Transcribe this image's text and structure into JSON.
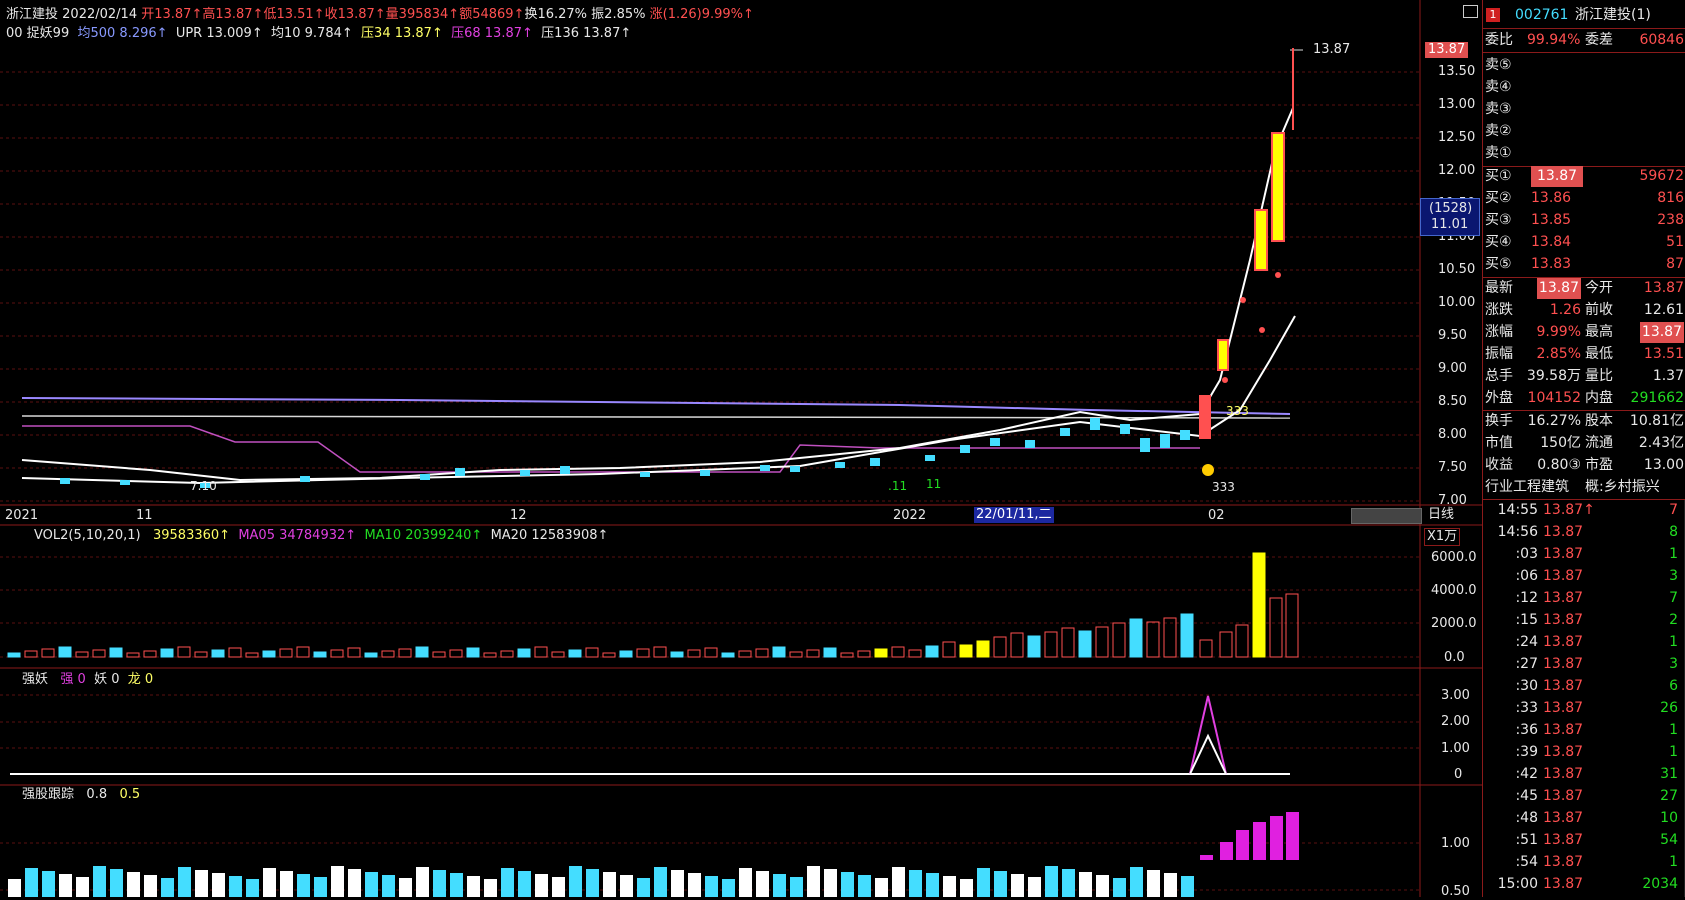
{
  "header": {
    "stock_name": "浙江建投",
    "date": "2022/02/14",
    "open": "开13.87↑",
    "high": "高13.87↑",
    "low": "低13.51↑",
    "close": "收13.87↑",
    "volume": "量395834↑",
    "amount": "额54869↑",
    "turnover": "换16.27%",
    "amplitude": "振2.85%",
    "change": "涨(1.26)9.99%↑"
  },
  "indicator_line": {
    "prefix": "00 捉妖99",
    "ma500": "均500 8.296↑",
    "upr": "UPR 13.009↑",
    "ma10": "均10 9.784↑",
    "p34": "压34 13.87↑",
    "p68": "压68 13.87↑",
    "p136": "压136 13.87↑"
  },
  "price_axis": [
    "13.50",
    "13.00",
    "12.50",
    "12.00",
    "11.50",
    "11.00",
    "10.50",
    "10.00",
    "9.50",
    "9.00",
    "8.50",
    "8.00",
    "7.50",
    "7.00"
  ],
  "price_tag_top": "13.87",
  "price_marker_label": "13.87",
  "crosshair_box": {
    "count": "(1528)",
    "price": "11.01"
  },
  "time_axis": {
    "labels": [
      "2021",
      "11",
      "12",
      "2022",
      "02"
    ],
    "cursor_date": "22/01/11,二",
    "period": "日线"
  },
  "chart_marks": {
    "low_label": "7.10",
    "mark_11a": ".11",
    "mark_11b": "11",
    "mark_333a": "333",
    "mark_333b": "333"
  },
  "volume_panel": {
    "title": "VOL2(5,10,20,1)",
    "vol": "39583360↑",
    "ma05": "MA05 34784932↑",
    "ma10": "MA10 20399240↑",
    "ma20": "MA20 12583908↑",
    "unit": "X1万",
    "axis": [
      "6000.0",
      "4000.0",
      "2000.0",
      "0.0"
    ]
  },
  "qiangyao_panel": {
    "title": "强妖",
    "qiang": "强 0",
    "yao": "妖 0",
    "long": "龙 0",
    "axis": [
      "3.00",
      "2.00",
      "1.00",
      "0"
    ]
  },
  "qiangu_panel": {
    "title": "强股跟踪",
    "v1": "0.8",
    "v2": "0.5",
    "axis": [
      "1.00",
      "0.50"
    ]
  },
  "quote": {
    "code": "002761",
    "name": "浙江建投(1)",
    "weibi_label": "委比",
    "weibi": "99.94%",
    "weicha_label": "委差",
    "weicha": "60846",
    "sell": [
      {
        "label": "卖⑤",
        "price": "",
        "vol": ""
      },
      {
        "label": "卖④",
        "price": "",
        "vol": ""
      },
      {
        "label": "卖③",
        "price": "",
        "vol": ""
      },
      {
        "label": "卖②",
        "price": "",
        "vol": ""
      },
      {
        "label": "卖①",
        "price": "",
        "vol": ""
      }
    ],
    "buy": [
      {
        "label": "买①",
        "price": "13.87",
        "vol": "59672"
      },
      {
        "label": "买②",
        "price": "13.86",
        "vol": "816"
      },
      {
        "label": "买③",
        "price": "13.85",
        "vol": "238"
      },
      {
        "label": "买④",
        "price": "13.84",
        "vol": "51"
      },
      {
        "label": "买⑤",
        "price": "13.83",
        "vol": "87"
      }
    ],
    "stats": [
      {
        "l1": "最新",
        "v1": "13.87",
        "l2": "今开",
        "v2": "13.87"
      },
      {
        "l1": "涨跌",
        "v1": "1.26",
        "l2": "前收",
        "v2": "12.61"
      },
      {
        "l1": "涨幅",
        "v1": "9.99%",
        "l2": "最高",
        "v2": "13.87"
      },
      {
        "l1": "振幅",
        "v1": "2.85%",
        "l2": "最低",
        "v2": "13.51"
      },
      {
        "l1": "总手",
        "v1": "39.58万",
        "l2": "量比",
        "v2": "1.37"
      },
      {
        "l1": "外盘",
        "v1": "104152",
        "l2": "内盘",
        "v2": "291662"
      }
    ],
    "fin": [
      {
        "l1": "换手",
        "v1": "16.27%",
        "l2": "股本",
        "v2": "10.81亿"
      },
      {
        "l1": "市值",
        "v1": "150亿",
        "l2": "流通",
        "v2": "2.43亿"
      },
      {
        "l1": "收益",
        "v1": "0.80③",
        "l2": "市盈",
        "v2": "13.00"
      }
    ],
    "industry": "行业工程建筑",
    "concept": "概:乡村振兴",
    "ticks": [
      {
        "t": "14:55",
        "p": "13.87↑",
        "v": "7"
      },
      {
        "t": "14:56",
        "p": "13.87",
        "v": "8"
      },
      {
        "t": ":03",
        "p": "13.87",
        "v": "1"
      },
      {
        "t": ":06",
        "p": "13.87",
        "v": "3"
      },
      {
        "t": ":12",
        "p": "13.87",
        "v": "7"
      },
      {
        "t": ":15",
        "p": "13.87",
        "v": "2"
      },
      {
        "t": ":24",
        "p": "13.87",
        "v": "1"
      },
      {
        "t": ":27",
        "p": "13.87",
        "v": "3"
      },
      {
        "t": ":30",
        "p": "13.87",
        "v": "6"
      },
      {
        "t": ":33",
        "p": "13.87",
        "v": "26"
      },
      {
        "t": ":36",
        "p": "13.87",
        "v": "1"
      },
      {
        "t": ":39",
        "p": "13.87",
        "v": "1"
      },
      {
        "t": ":42",
        "p": "13.87",
        "v": "31"
      },
      {
        "t": ":45",
        "p": "13.87",
        "v": "27"
      },
      {
        "t": ":48",
        "p": "13.87",
        "v": "10"
      },
      {
        "t": ":51",
        "p": "13.87",
        "v": "54"
      },
      {
        "t": ":54",
        "p": "13.87",
        "v": "1"
      },
      {
        "t": "15:00",
        "p": "13.87",
        "v": "2034"
      }
    ]
  }
}
